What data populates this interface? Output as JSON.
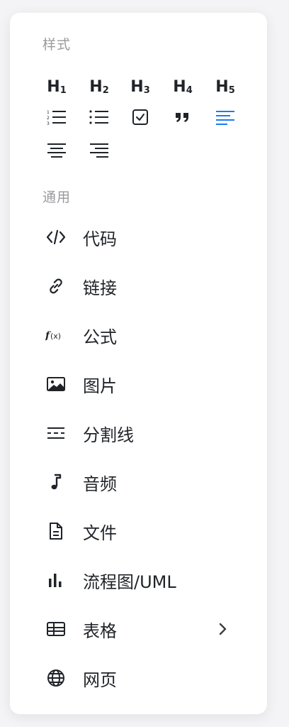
{
  "styles_section": {
    "title": "样式",
    "headings": [
      {
        "label": "H",
        "level": "1"
      },
      {
        "label": "H",
        "level": "2"
      },
      {
        "label": "H",
        "level": "3"
      },
      {
        "label": "H",
        "level": "4"
      },
      {
        "label": "H",
        "level": "5"
      }
    ],
    "row2_icons": [
      "ordered-list-icon",
      "bullet-list-icon",
      "checkbox-icon",
      "quote-icon",
      "align-left-icon"
    ],
    "row3_icons": [
      "align-center-icon",
      "align-right-icon"
    ],
    "active_color": "#1a7cf3"
  },
  "general_section": {
    "title": "通用",
    "items": [
      {
        "label": "代码",
        "icon": "code-icon"
      },
      {
        "label": "链接",
        "icon": "link-icon"
      },
      {
        "label": "公式",
        "icon": "formula-icon"
      },
      {
        "label": "图片",
        "icon": "image-icon"
      },
      {
        "label": "分割线",
        "icon": "divider-icon"
      },
      {
        "label": "音频",
        "icon": "music-note-icon"
      },
      {
        "label": "文件",
        "icon": "file-icon"
      },
      {
        "label": "流程图/UML",
        "icon": "bar-chart-icon"
      },
      {
        "label": "表格",
        "icon": "table-icon"
      },
      {
        "label": "网页",
        "icon": "globe-icon"
      }
    ]
  },
  "colors": {
    "text": "#1f2328",
    "muted": "#9a9a9e",
    "accent": "#1a7cf3",
    "panel_bg": "#ffffff"
  }
}
